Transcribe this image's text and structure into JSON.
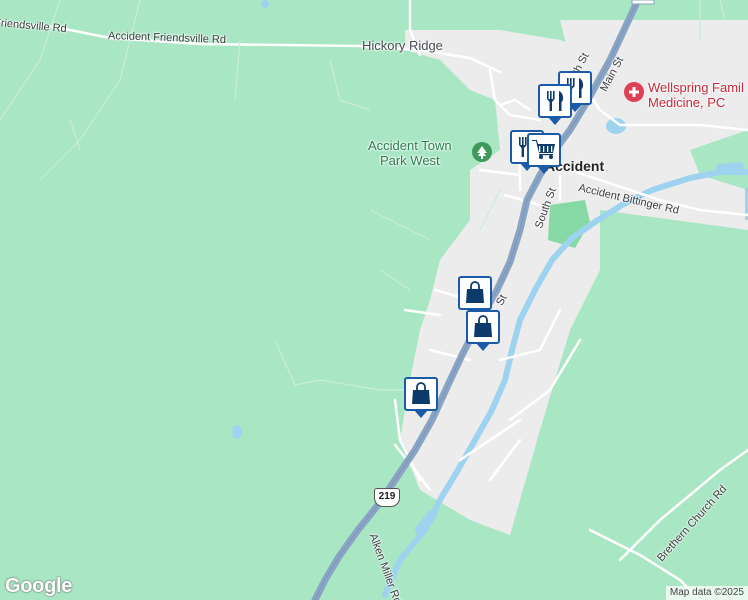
{
  "colors": {
    "land": "#a8e6c4",
    "town_area": "#ececec",
    "minor_road": "#ffffff",
    "highway": "#8aa4c4",
    "water": "#9ed3f0",
    "park": "#86d8a4",
    "pin_border": "#1a5aa6",
    "medical": "#e04055",
    "park_icon": "#3e9a5c"
  },
  "labels": {
    "friendsville_rd_west": "Friendsville Rd",
    "accident_friendsville_rd": "Accident Friendsville Rd",
    "hickory_ridge": "Hickory Ridge",
    "park_line1": "Accident Town",
    "park_line2": "Park West",
    "medical_line1": "Wellspring Famil",
    "medical_line2": "Medicine, PC",
    "town": "Accident",
    "n_south_st": "N South St",
    "main_st": "Main St",
    "main_st_short": "St",
    "south_st": "South St",
    "accident_bittinger_rd": "Accident Bittinger Rd",
    "us_219_shield": "219",
    "alken_miller_rd": "Alken Miller Rd",
    "brethern_church_rd": "Brethern Church Rd"
  },
  "pins": [
    {
      "name": "restaurant-pin-1",
      "icon": "fork-knife-icon"
    },
    {
      "name": "restaurant-pin-2",
      "icon": "fork-knife-icon"
    },
    {
      "name": "restaurant-pin-3",
      "icon": "fork-knife-icon"
    },
    {
      "name": "grocery-pin",
      "icon": "shopping-cart-icon"
    },
    {
      "name": "store-pin-1",
      "icon": "shopping-bag-icon"
    },
    {
      "name": "store-pin-2",
      "icon": "shopping-bag-icon"
    },
    {
      "name": "store-pin-3",
      "icon": "shopping-bag-icon"
    }
  ],
  "footer": {
    "logo": "Google",
    "attribution": "Map data ©2025"
  }
}
